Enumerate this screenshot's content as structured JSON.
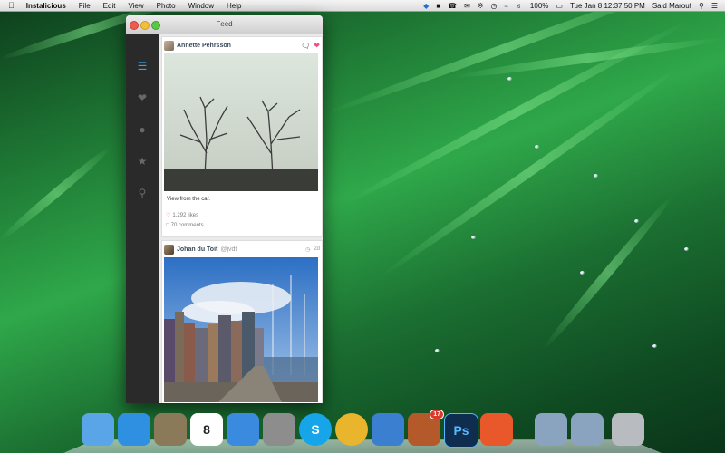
{
  "menubar": {
    "app_name": "Instalicious",
    "menus": [
      "File",
      "Edit",
      "View",
      "Photo",
      "Window",
      "Help"
    ],
    "battery": "100%",
    "clock": "Tue Jan 8  12:37:50 PM",
    "user": "Said Marouf"
  },
  "window": {
    "title": "Feed"
  },
  "sidebar": {
    "items": [
      {
        "icon": "menu-icon",
        "active": true
      },
      {
        "icon": "heart-icon",
        "active": false
      },
      {
        "icon": "user-icon",
        "active": false
      },
      {
        "icon": "star-icon",
        "active": false
      },
      {
        "icon": "search-icon",
        "active": false
      }
    ]
  },
  "posts": [
    {
      "username": "Annette Pehrsson",
      "handle": "",
      "time": "",
      "caption": "View from the car.",
      "likes": "1,292 likes",
      "comments": "70 comments"
    },
    {
      "username": "Johan du Toit",
      "handle": "@jvdt",
      "time": "2d",
      "caption": "",
      "likes": "",
      "comments": ""
    }
  ],
  "dock": {
    "items": [
      {
        "name": "finder-icon",
        "color": "#5aa4e8"
      },
      {
        "name": "app-store-icon",
        "color": "#2f8fe0"
      },
      {
        "name": "mail-stamp-icon",
        "color": "#8a7a5a"
      },
      {
        "name": "calendar-icon",
        "color": "#ffffff",
        "label": "8"
      },
      {
        "name": "itunes-icon",
        "color": "#3a8be0"
      },
      {
        "name": "system-preferences-icon",
        "color": "#8d8d8d"
      },
      {
        "name": "skype-icon",
        "color": "#16a5e8",
        "label": "S"
      },
      {
        "name": "chrome-icon",
        "color": "#e8b52d"
      },
      {
        "name": "xcode-icon",
        "color": "#3a7fd0"
      },
      {
        "name": "birdhouse-icon",
        "color": "#b45a2a",
        "badge": "17"
      },
      {
        "name": "photoshop-icon",
        "color": "#0f2d4f",
        "label": "Ps"
      },
      {
        "name": "slides-app-icon",
        "color": "#e8582a"
      },
      {
        "name": "documents-folder-icon",
        "color": "#8aa4c0"
      },
      {
        "name": "downloads-folder-icon",
        "color": "#8aa4c0"
      },
      {
        "name": "trash-icon",
        "color": "#b8bcc0"
      }
    ]
  }
}
